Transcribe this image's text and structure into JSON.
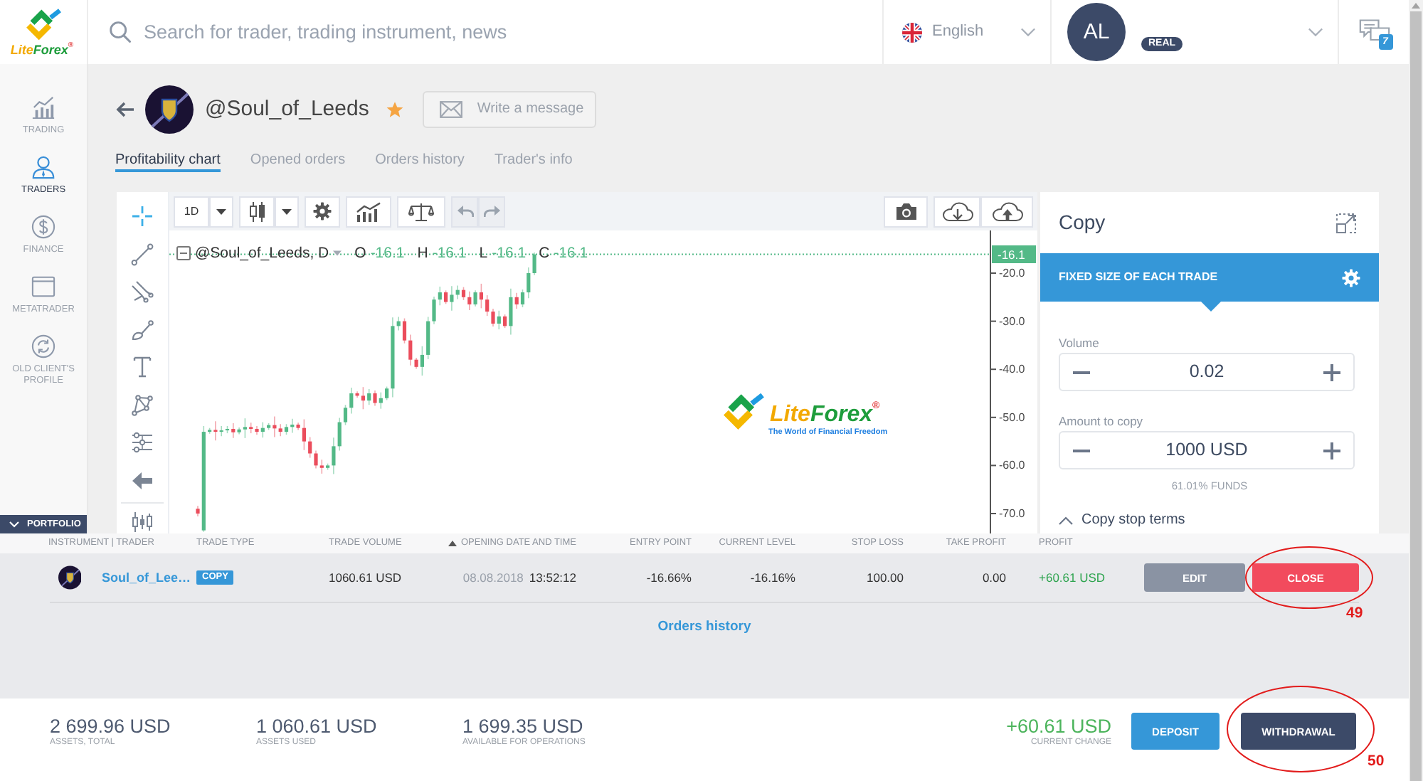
{
  "header": {
    "logo": {
      "parts": [
        "Lite",
        "Forex"
      ],
      "mark": "®"
    },
    "search": {
      "placeholder": "Search for trader, trading instrument, news"
    },
    "language": {
      "label": "English"
    },
    "account": {
      "initials": "AL",
      "type": "REAL"
    },
    "messages": {
      "count": "7"
    }
  },
  "sidebar": {
    "items": [
      {
        "kind": "trading",
        "label": "TRADING",
        "selected": false
      },
      {
        "kind": "traders",
        "label": "TRADERS",
        "selected": true
      },
      {
        "kind": "finance",
        "label": "FINANCE",
        "selected": false
      },
      {
        "kind": "metatrader",
        "label": "METATRADER",
        "selected": false
      },
      {
        "kind": "profile",
        "label": "OLD CLIENT'S PROFILE",
        "selected": false
      }
    ],
    "portfolio": {
      "label": "PORTFOLIO",
      "expanded": true
    }
  },
  "trader": {
    "name": "@Soul_of_Leeds",
    "favorite": true,
    "message_button": "Write a message"
  },
  "tabs": [
    {
      "label": "Profitability chart",
      "selected": true
    },
    {
      "label": "Opened orders",
      "selected": false
    },
    {
      "label": "Orders history",
      "selected": false
    },
    {
      "label": "Trader's info",
      "selected": false
    }
  ],
  "chart": {
    "interval": "1D",
    "tools": [
      {
        "kind": "crosshair",
        "selected": true
      },
      {
        "kind": "trend-line",
        "selected": false
      },
      {
        "kind": "pitchfork",
        "selected": false
      },
      {
        "kind": "brush",
        "selected": false
      },
      {
        "kind": "text",
        "selected": false
      },
      {
        "kind": "pattern",
        "selected": false
      },
      {
        "kind": "measure",
        "selected": false
      },
      {
        "kind": "back",
        "selected": false
      },
      {
        "kind": "bars",
        "selected": false
      }
    ],
    "legend": {
      "title": "@Soul_of_Leeds, D",
      "values": [
        {
          "key": "O",
          "value": "-16.1"
        },
        {
          "key": "H",
          "value": "-16.1"
        },
        {
          "key": "L",
          "value": "-16.1"
        },
        {
          "key": "C",
          "value": "-16.1"
        }
      ]
    },
    "last_price": "-16.1",
    "price_labels": [
      "-20.0",
      "-30.0",
      "-40.0",
      "-50.0",
      "-60.0",
      "-70.0"
    ],
    "logo": {
      "parts": [
        "Lite",
        "Forex"
      ],
      "mark": "®",
      "tagline": "The World of Financial Freedom"
    }
  },
  "copy_panel": {
    "title": "Copy",
    "mode": "FIXED SIZE OF EACH TRADE",
    "fields": [
      {
        "label": "Volume",
        "value": "0.02"
      },
      {
        "label": "Amount to copy",
        "value": "1000 USD",
        "note": "61.01% FUNDS"
      }
    ],
    "stop_terms": "Copy stop terms"
  },
  "portfolio": {
    "columns": [
      {
        "label": "INSTRUMENT | TRADER",
        "sorted": false
      },
      {
        "label": "TRADE TYPE",
        "sorted": false
      },
      {
        "label": "TRADE VOLUME",
        "sorted": false
      },
      {
        "label": "OPENING DATE AND TIME",
        "sorted": true
      },
      {
        "label": "ENTRY POINT",
        "sorted": false
      },
      {
        "label": "CURRENT LEVEL",
        "sorted": false
      },
      {
        "label": "STOP LOSS",
        "sorted": false
      },
      {
        "label": "TAKE PROFIT",
        "sorted": false
      },
      {
        "label": "PROFIT",
        "sorted": false
      }
    ],
    "rows": [
      {
        "trader": "Soul_of_Lee…",
        "trade_type": "COPY",
        "trade_volume": "1060.61 USD",
        "open_date": "08.08.2018",
        "open_time": "13:52:12",
        "entry_point": "-16.66%",
        "current_level": "-16.16%",
        "stop_loss": "100.00",
        "take_profit": "0.00",
        "profit": "+60.61 USD",
        "actions": [
          {
            "label": "EDIT",
            "kind": "edit"
          },
          {
            "label": "CLOSE",
            "kind": "close",
            "callout": "49"
          }
        ]
      }
    ],
    "orders_history_link": "Orders history"
  },
  "summary": {
    "stats": [
      {
        "value": "2 699.96 USD",
        "label": "ASSETS, TOTAL"
      },
      {
        "value": "1 060.61 USD",
        "label": "ASSETS USED"
      },
      {
        "value": "1 699.35 USD",
        "label": "AVAILABLE FOR OPERATIONS"
      }
    ],
    "change": {
      "value": "+60.61 USD",
      "label": "CURRENT CHANGE"
    },
    "buttons": [
      {
        "label": "DEPOSIT",
        "kind": "deposit"
      },
      {
        "label": "WITHDRAWAL",
        "kind": "withdrawal",
        "callout": "50"
      }
    ]
  }
}
